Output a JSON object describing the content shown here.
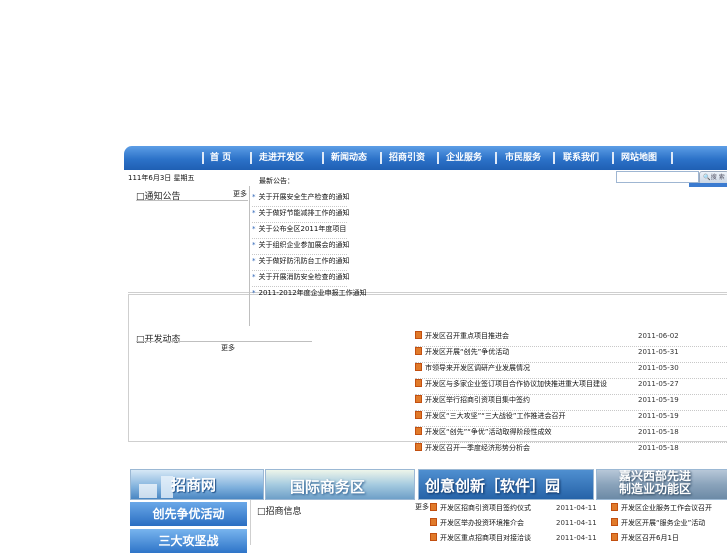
{
  "nav": {
    "items": [
      "首 页",
      "走进开发区",
      "新闻动态",
      "招商引资",
      "企业服务",
      "市民服务",
      "联系我们",
      "网站地图"
    ]
  },
  "search": {
    "placeholder": "",
    "button": "搜 索"
  },
  "date_line": "111年6月3日 星期五",
  "section1": {
    "title": "□通知公告",
    "more": "更多",
    "list_header": "最新公告：",
    "items": [
      "关于开展安全生产检查的通知",
      "关于做好节能减排工作的通知",
      "关于公布全区2011年度项目",
      "关于组织企业参加展会的通知",
      "关于做好防汛防台工作的通知",
      "关于开展消防安全检查的通知",
      "2011-2012年度企业申报工作通知"
    ]
  },
  "section2": {
    "title": "□开发动态",
    "more": "更多",
    "news": [
      {
        "title": "开发区召开重点项目推进会",
        "date": "2011-06-02"
      },
      {
        "title": "开发区开展“创先”争优活动",
        "date": "2011-05-31"
      },
      {
        "title": "市领导来开发区调研产业发展情况",
        "date": "2011-05-30"
      },
      {
        "title": "开发区与多家企业签订项目合作协议加快推进重大项目建设",
        "date": "2011-05-27"
      },
      {
        "title": "开发区举行招商引资项目集中签约",
        "date": "2011-05-19"
      },
      {
        "title": "开发区“三大攻坚”“三大战役”工作推进会召开",
        "date": "2011-05-19"
      },
      {
        "title": "开发区“创先”“争优”活动取得阶段性成效",
        "date": "2011-05-18"
      },
      {
        "title": "开发区召开一季度经济形势分析会",
        "date": "2011-05-18"
      }
    ]
  },
  "banners": {
    "b1": "招商网",
    "b2": "国际商务区",
    "b3": "创意创新［软件］园",
    "b4_line1": "嘉兴西部先进",
    "b4_line2": "制造业功能区"
  },
  "side_banners": [
    "创先争优活动",
    "三大攻坚战"
  ],
  "section3": {
    "title": "□招商信息",
    "more": "更多",
    "items": [
      {
        "title": "开发区招商引资项目签约仪式",
        "date": "2011-04-11"
      },
      {
        "title": "开发区举办投资环境推介会",
        "date": "2011-04-11"
      },
      {
        "title": "开发区重点招商项目对接洽谈",
        "date": "2011-04-11"
      }
    ]
  },
  "section4": {
    "items": [
      "开发区企业服务工作会议召开",
      "开发区开展“服务企业”活动",
      "开发区召开6月1日"
    ]
  },
  "colors": {
    "nav_top": "#5d9ee6",
    "nav_bottom": "#1f5fb3",
    "accent_red": "#e04a2a"
  }
}
